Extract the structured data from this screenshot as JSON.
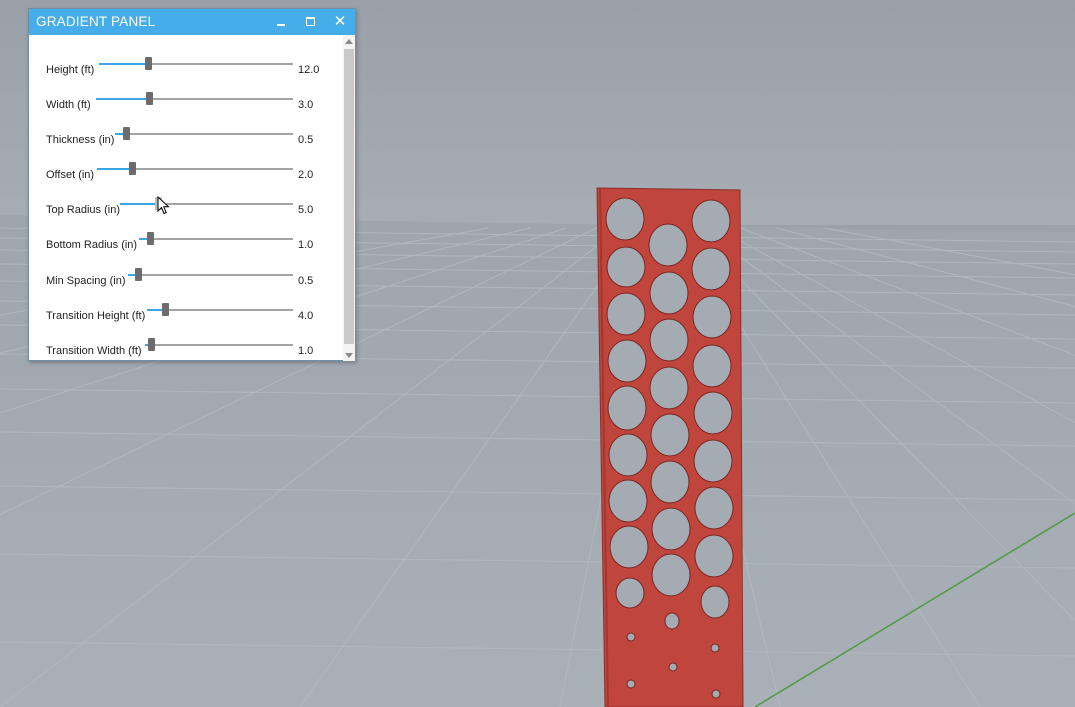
{
  "panel": {
    "title": "GRADIENT PANEL",
    "buttons": {
      "minimize": "minimize-icon",
      "maximize": "maximize-icon",
      "close": "close-icon"
    },
    "close_glyph": "✕"
  },
  "sliders": [
    {
      "label": "Height (ft)",
      "value": "12.0",
      "level": 0.25
    },
    {
      "label": "Width (ft)",
      "value": "3.0",
      "level": 0.27
    },
    {
      "label": "Thickness (in)",
      "value": "0.5",
      "level": 0.06
    },
    {
      "label": "Offset (in)",
      "value": "2.0",
      "level": 0.18
    },
    {
      "label": "Top Radius (in)",
      "value": "5.0",
      "level": 0.22
    },
    {
      "label": "Bottom Radius (in)",
      "value": "1.0",
      "level": 0.07
    },
    {
      "label": "Min Spacing (in)",
      "value": "0.5",
      "level": 0.06
    },
    {
      "label": "Transition Height (ft)",
      "value": "4.0",
      "level": 0.12
    },
    {
      "label": "Transition Width (ft)",
      "value": "1.0",
      "level": 0.04
    }
  ],
  "colors": {
    "titlebar": "#45aeea",
    "slider_fill": "#3aa6e6",
    "panel_object": "#c0463d",
    "ground": "#a4abb2",
    "sky": "#9aa1a9",
    "axis_line": "#4f9a45"
  }
}
